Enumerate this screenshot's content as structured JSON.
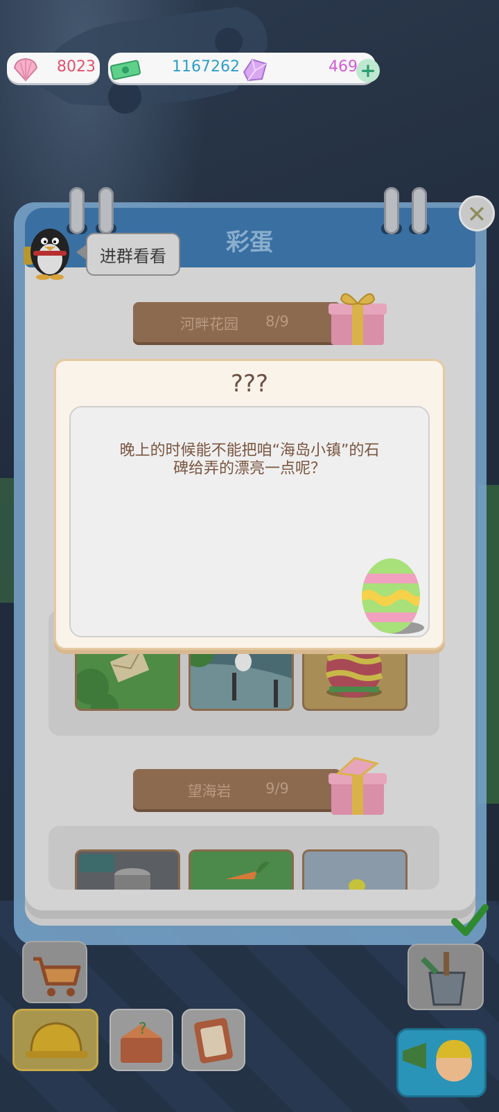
{
  "resources": {
    "shells": "8023",
    "cash": "1167262",
    "gems": "469",
    "plus_label": "+"
  },
  "panel": {
    "title": "彩蛋",
    "close_label": "✕",
    "group_chat_label": "进群看看"
  },
  "sections": [
    {
      "name": "河畔花园",
      "progress": "8/9"
    },
    {
      "name": "望海岩",
      "progress": "9/9"
    }
  ],
  "dialog": {
    "title": "???",
    "message_line1": "晚上的时候能不能把咱“海岛小镇”的石",
    "message_line2": "碑给弄的漂亮一点呢？"
  },
  "colors": {
    "panel_header": "#3a6fa2",
    "banner": "#8c6a50",
    "dialog_bg": "#faf3ea",
    "dialog_text": "#7a5540"
  }
}
